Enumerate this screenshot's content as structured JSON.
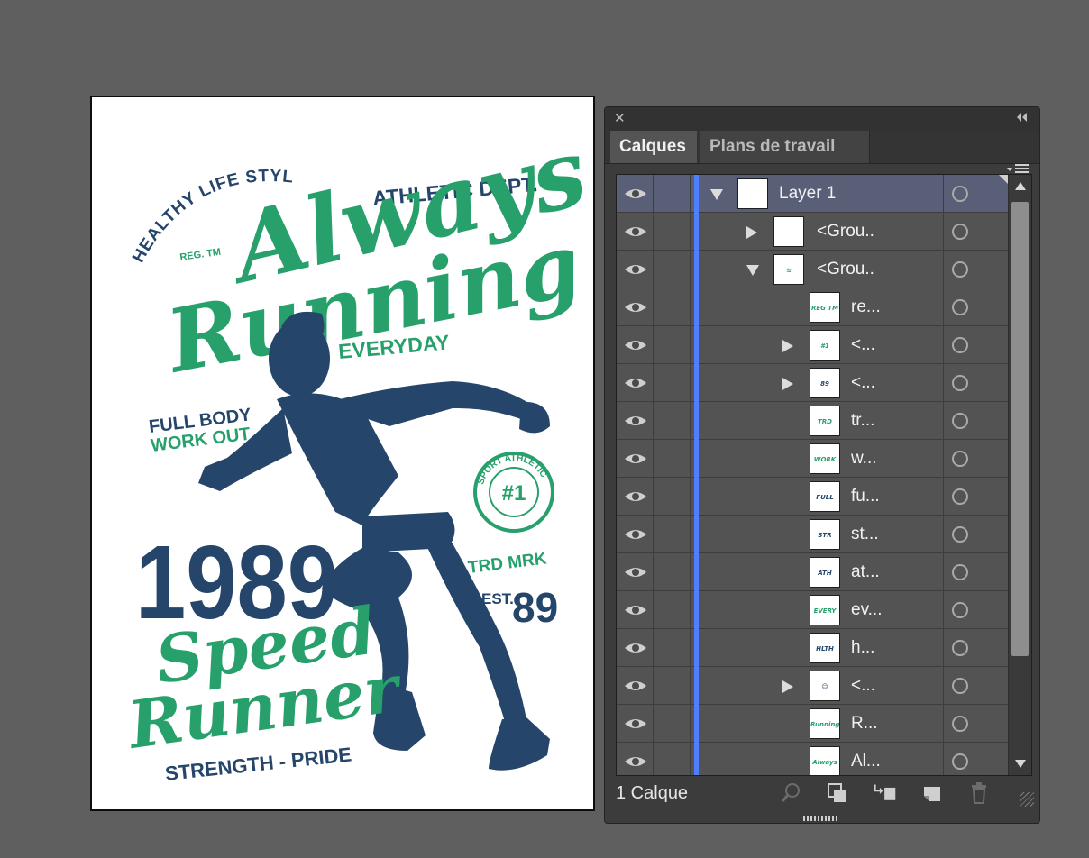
{
  "artwork": {
    "healthy": "HEALTHY LIFE STYLE",
    "athletic": "ATHLETIC DEPT.",
    "reg": "REG. TM",
    "always": "Always",
    "running": "Running",
    "everyday": "EVERYDAY",
    "full_body": "FULL BODY",
    "work_out": "WORK OUT",
    "year": "1989",
    "badge_ring": "SPORT ATHLETIC",
    "badge_center": "#1",
    "trd": "TRD MRK",
    "est": "EST.",
    "est_num": "89",
    "speed": "Speed",
    "runner": "Runner",
    "strength": "STRENGTH - PRIDE"
  },
  "colors": {
    "green": "#27a06b",
    "navy": "#25456a",
    "selection": "#5a5f78",
    "layer_color": "#4f7eff"
  },
  "panel": {
    "tabs": [
      "Calques",
      "Plans de travail"
    ],
    "footer_count": "1 Calque",
    "layers": [
      {
        "name": "Layer 1",
        "expand": "down",
        "thumb": ""
      },
      {
        "name": "<Grou..",
        "expand": "right",
        "thumb": ""
      },
      {
        "name": "<Grou..",
        "expand": "down",
        "thumb": "≋"
      },
      {
        "name": "re...",
        "expand": "none",
        "thumb": "REG TM"
      },
      {
        "name": "<...",
        "expand": "right",
        "thumb": "#1"
      },
      {
        "name": "<...",
        "expand": "right",
        "thumb": "89"
      },
      {
        "name": "tr...",
        "expand": "none",
        "thumb": "TRD MRK"
      },
      {
        "name": "w...",
        "expand": "none",
        "thumb": "WORK"
      },
      {
        "name": "fu...",
        "expand": "none",
        "thumb": "FULL"
      },
      {
        "name": "st...",
        "expand": "none",
        "thumb": "STR"
      },
      {
        "name": "at...",
        "expand": "none",
        "thumb": "ATH"
      },
      {
        "name": "ev...",
        "expand": "none",
        "thumb": "EVERY"
      },
      {
        "name": "h...",
        "expand": "none",
        "thumb": "HLTH"
      },
      {
        "name": "<...",
        "expand": "right",
        "thumb": "☺"
      },
      {
        "name": "R...",
        "expand": "none",
        "thumb": "Running"
      },
      {
        "name": "Al...",
        "expand": "none",
        "thumb": "Always"
      }
    ]
  }
}
